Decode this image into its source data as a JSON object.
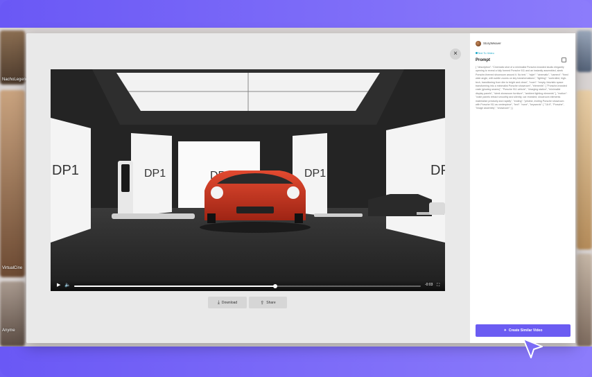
{
  "background_labels": [
    "NachoLegend",
    "VirtualCine",
    "Anyme"
  ],
  "modal": {
    "close_icon": "×",
    "video": {
      "brand_text": "DP1",
      "time": "-0:03",
      "progress": 0.58
    },
    "buttons": {
      "download": "Download",
      "share": "Share"
    }
  },
  "panel": {
    "username": "StoryWeaver",
    "type_tag": "Text To Video",
    "prompt_title": "Prompt",
    "prompt_text": "{ \"description\": \"Cinematic shot of a minimalist Porsche-branded studio elegantly opening to reveal a fully formed Porsche 911 and an instantly assembled, sleek Porsche-themed showroom around it. No text.\", \"style\": \"cinematic\", \"camera\": \"fixed wide angle, with subtle zooms on key transformations\", \"lighting\": \"controlled, high-tech, transitioning from dim to bright and clean\", \"room\": \"empty, futuristic space transforming into a minimalist Porsche showroom\", \"elements\": [ \"Porsche-branded crate (glowing seams)\", \"Porsche 911 vehicle\", \"charging station\", \"minimalist display panels\", \"sleek showroom furniture\", \"ambient lighting elements\" ], \"motion\": \"crate panels retract smoothly and silently; car revealed; showroom elements materialize precisely and rapidly\", \"ending\": \"pristine, inviting Porsche showroom with Porsche 911 as centerpiece\", \"text\": \"none\", \"keywords\": [ \"16:9\", \"Porsche\", \"image assembly\", \"showroom\" ] }",
    "create_button": "Create Similar Video"
  },
  "colors": {
    "accent": "#6b5cf2",
    "tag": "#1aa8c9",
    "car": "#d8351f"
  }
}
